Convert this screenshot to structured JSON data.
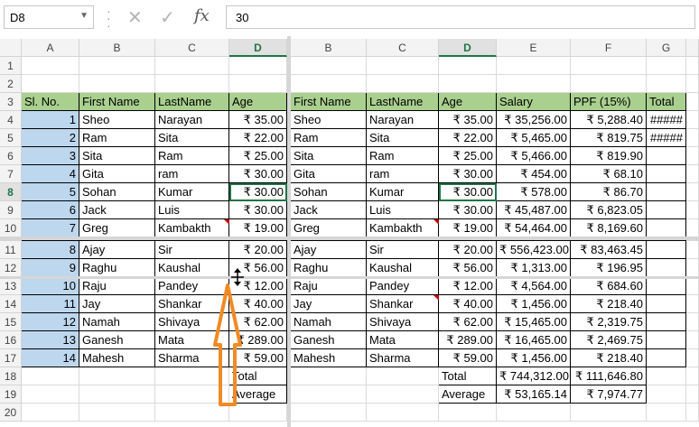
{
  "formula_bar": {
    "name_box": "D8",
    "formula": "30"
  },
  "left_pane": {
    "columns": [
      "A",
      "B",
      "C",
      "D"
    ],
    "header": [
      "Sl. No.",
      "First Name",
      "LastName",
      "Age"
    ],
    "rows": [
      [
        "1",
        "Sheo",
        "Narayan",
        "₹ 35.00"
      ],
      [
        "2",
        "Ram",
        "Sita",
        "₹ 22.00"
      ],
      [
        "3",
        "Sita",
        "Ram",
        "₹ 25.00"
      ],
      [
        "4",
        "Gita",
        "ram",
        "₹ 30.00"
      ],
      [
        "5",
        "Sohan",
        "Kumar",
        "₹ 30.00"
      ],
      [
        "6",
        "Jack",
        "Luis",
        "₹ 30.00"
      ],
      [
        "7",
        "Greg",
        "Kambakth",
        "₹ 19.00"
      ],
      [
        "8",
        "Ajay",
        "Sir",
        "₹ 20.00"
      ],
      [
        "9",
        "Raghu",
        "Kaushal",
        "₹ 56.00"
      ],
      [
        "10",
        "Raju",
        "Pandey",
        "₹ 12.00"
      ],
      [
        "11",
        "Jay",
        "Shankar",
        "₹ 40.00"
      ],
      [
        "12",
        "Namah",
        "Shivaya",
        "₹ 62.00"
      ],
      [
        "13",
        "Ganesh",
        "Mata",
        "₹ 289.00"
      ],
      [
        "14",
        "Mahesh",
        "Sharma",
        "₹ 59.00"
      ]
    ],
    "total_label": "Total",
    "average_label": "Average"
  },
  "right_pane": {
    "columns": [
      "B",
      "C",
      "D",
      "E",
      "F",
      "G"
    ],
    "header": [
      "First Name",
      "LastName",
      "Age",
      "Salary",
      "PPF (15%)",
      "Total"
    ],
    "rows": [
      [
        "Sheo",
        "Narayan",
        "₹ 35.00",
        "₹ 35,256.00",
        "₹ 5,288.40",
        "#####"
      ],
      [
        "Ram",
        "Sita",
        "₹ 22.00",
        "₹ 5,465.00",
        "₹ 819.75",
        "#####"
      ],
      [
        "Sita",
        "Ram",
        "₹ 25.00",
        "₹ 5,466.00",
        "₹ 819.90",
        ""
      ],
      [
        "Gita",
        "ram",
        "₹ 30.00",
        "₹ 454.00",
        "₹ 68.10",
        ""
      ],
      [
        "Sohan",
        "Kumar",
        "₹ 30.00",
        "₹ 578.00",
        "₹ 86.70",
        ""
      ],
      [
        "Jack",
        "Luis",
        "₹ 30.00",
        "₹ 45,487.00",
        "₹ 6,823.05",
        ""
      ],
      [
        "Greg",
        "Kambakth",
        "₹ 19.00",
        "₹ 54,464.00",
        "₹ 8,169.60",
        ""
      ],
      [
        "Ajay",
        "Sir",
        "₹ 20.00",
        "₹ 556,423.00",
        "₹ 83,463.45",
        ""
      ],
      [
        "Raghu",
        "Kaushal",
        "₹ 56.00",
        "₹ 1,313.00",
        "₹ 196.95",
        ""
      ],
      [
        "Raju",
        "Pandey",
        "₹ 12.00",
        "₹ 4,564.00",
        "₹ 684.60",
        ""
      ],
      [
        "Jay",
        "Shankar",
        "₹ 40.00",
        "₹ 1,456.00",
        "₹ 218.40",
        ""
      ],
      [
        "Namah",
        "Shivaya",
        "₹ 62.00",
        "₹ 15,465.00",
        "₹ 2,319.75",
        ""
      ],
      [
        "Ganesh",
        "Mata",
        "₹ 289.00",
        "₹ 16,465.00",
        "₹ 2,469.75",
        ""
      ],
      [
        "Mahesh",
        "Sharma",
        "₹ 59.00",
        "₹ 1,456.00",
        "₹ 218.40",
        ""
      ]
    ],
    "total": {
      "label": "Total",
      "salary": "₹ 744,312.00",
      "ppf": "₹ 111,646.80"
    },
    "average": {
      "label": "Average",
      "salary": "₹ 53,165.14",
      "ppf": "₹ 7,974.77"
    }
  },
  "row_numbers": [
    "1",
    "2",
    "3",
    "4",
    "5",
    "6",
    "7",
    "8",
    "9",
    "10",
    "11",
    "12",
    "13",
    "14",
    "15",
    "16",
    "17",
    "18",
    "19",
    "20"
  ],
  "colors": {
    "header_fill": "#a9d08e",
    "serial_fill": "#bdd7ee",
    "select_green": "#217346",
    "arrow_orange": "#f08a24"
  }
}
